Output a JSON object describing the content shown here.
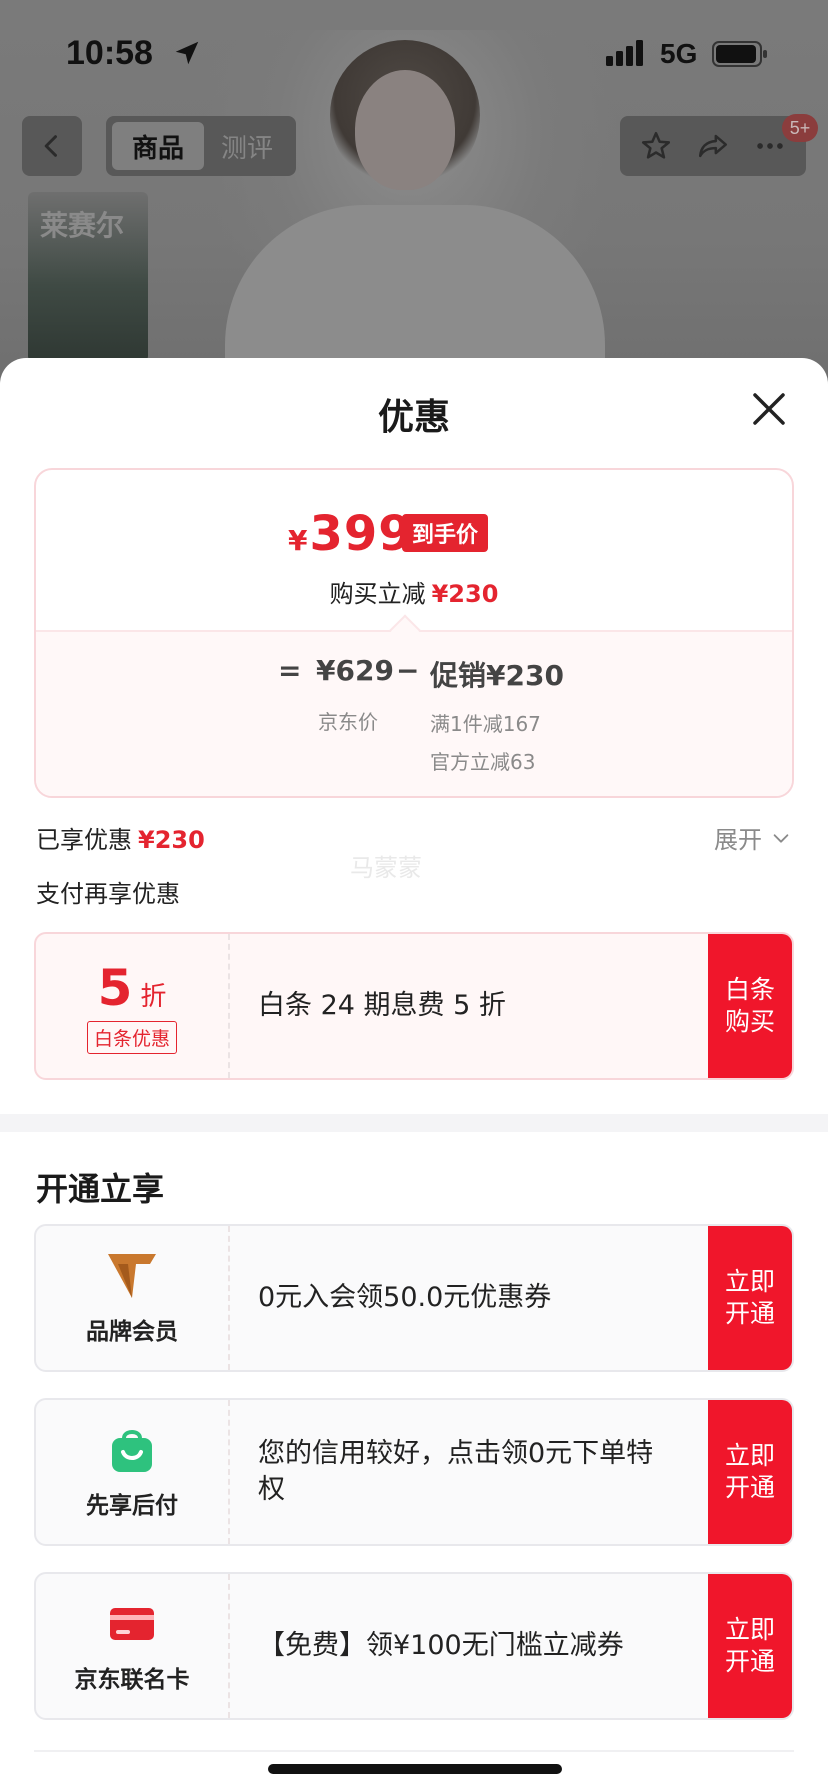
{
  "status_bar": {
    "time": "10:58",
    "network": "5G",
    "icons": [
      "location-arrow-icon",
      "signal-icon",
      "battery-icon"
    ]
  },
  "product_nav": {
    "tabs": [
      {
        "label": "商品"
      },
      {
        "label": "测评"
      }
    ],
    "badge": "5+",
    "brand_thumb_text": "莱赛尔",
    "icons": [
      "back-icon",
      "star-icon",
      "share-icon",
      "more-icon"
    ]
  },
  "sheet": {
    "title": "优惠",
    "price_card": {
      "currency": "¥",
      "final_price": "399",
      "final_price_tag": "到手价",
      "instant_discount_label": "购买立减",
      "instant_discount_value": "¥230",
      "equals": "=",
      "jd_price": "¥629",
      "minus": "−",
      "promo": "促销¥230",
      "jd_price_label": "京东价",
      "promo_details": [
        "满1件减167",
        "官方立减63"
      ]
    },
    "enjoyed_label": "已享优惠",
    "enjoyed_value": "¥230",
    "expand_label": "展开",
    "watermark": "马蒙蒙",
    "pay_more_title": "支付再享优惠",
    "baitiao_offer": {
      "discount_num": "5",
      "discount_unit": "折",
      "discount_tag": "白条优惠",
      "text": "白条 24 期息费 5 折",
      "button": "白条购买"
    },
    "membership_section": {
      "title": "开通立享",
      "offers": [
        {
          "icon": "brand-member-icon",
          "label": "品牌会员",
          "text": "0元入会领50.0元优惠券",
          "button": "立即开通"
        },
        {
          "icon": "shopping-bag-icon",
          "label": "先享后付",
          "text": "您的信用较好，点击领0元下单特权",
          "button": "立即开通"
        },
        {
          "icon": "credit-card-icon",
          "label": "京东联名卡",
          "text": "【免费】领¥100无门槛立减券",
          "button": "立即开通"
        }
      ]
    }
  },
  "colors": {
    "accent_red": "#e4242f",
    "button_red": "#f0162b",
    "member_gold": "#c9782e",
    "pay_later_green": "#2ec27e"
  }
}
